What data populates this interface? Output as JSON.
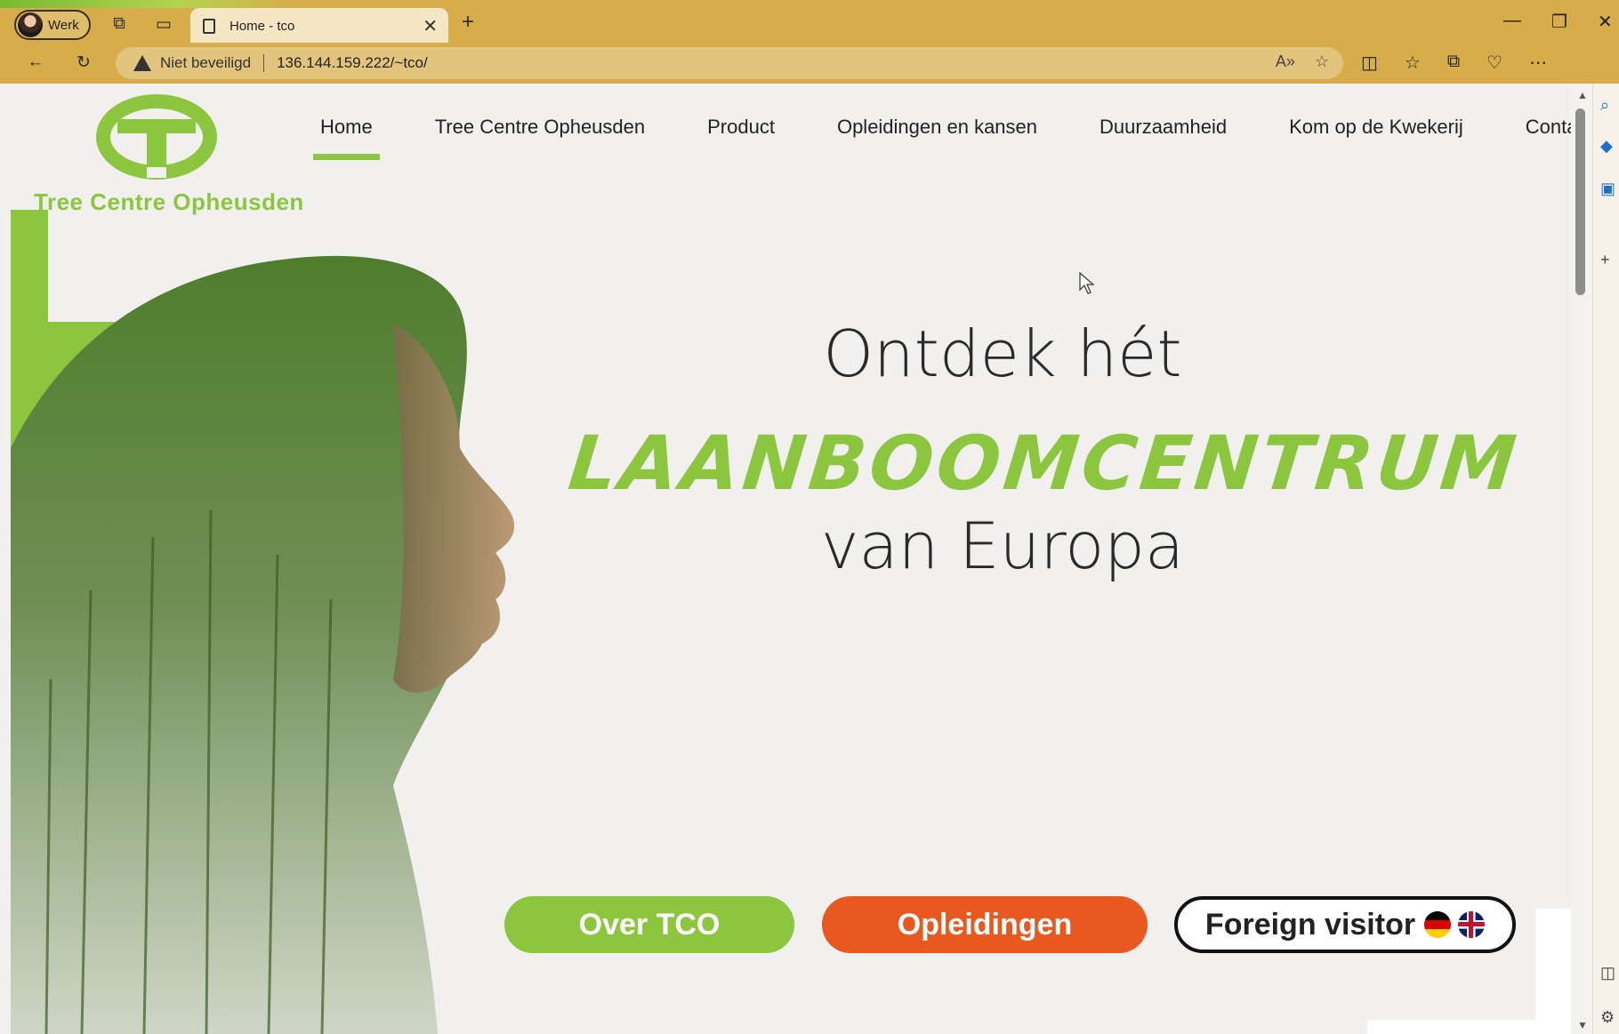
{
  "browser": {
    "profile_label": "Werk",
    "tab_title": "Home - tco",
    "security_label": "Niet beveiligd",
    "url": "136.144.159.222/~tco/"
  },
  "site": {
    "logo_text": "Tree Centre Opheusden",
    "nav": [
      {
        "label": "Home",
        "active": true
      },
      {
        "label": "Tree Centre Opheusden",
        "active": false
      },
      {
        "label": "Product",
        "active": false
      },
      {
        "label": "Opleidingen en kansen",
        "active": false
      },
      {
        "label": "Duurzaamheid",
        "active": false
      },
      {
        "label": "Kom op de Kwekerij",
        "active": false
      },
      {
        "label": "Contact",
        "active": false
      }
    ],
    "hero": {
      "line1": "Ontdek hét",
      "brand": "LAANBOOMCENTRUM",
      "line3": "van Europa"
    },
    "buttons": {
      "over": "Over TCO",
      "opleidingen": "Opleidingen",
      "foreign": "Foreign visitor"
    }
  },
  "colors": {
    "brand_green": "#8cc63e",
    "brand_orange": "#e8581f",
    "chrome": "#d6ad4a"
  }
}
